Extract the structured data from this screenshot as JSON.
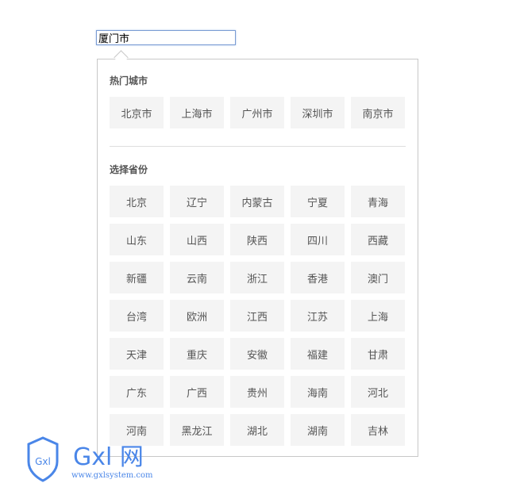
{
  "input": {
    "value": "厦门市"
  },
  "hot": {
    "title": "热门城市",
    "items": [
      "北京市",
      "上海市",
      "广州市",
      "深圳市",
      "南京市"
    ]
  },
  "provinces": {
    "title": "选择省份",
    "items": [
      "北京",
      "辽宁",
      "内蒙古",
      "宁夏",
      "青海",
      "山东",
      "山西",
      "陕西",
      "四川",
      "西藏",
      "新疆",
      "云南",
      "浙江",
      "香港",
      "澳门",
      "台湾",
      "欧洲",
      "江西",
      "江苏",
      "上海",
      "天津",
      "重庆",
      "安徽",
      "福建",
      "甘肃",
      "广东",
      "广西",
      "贵州",
      "海南",
      "河北",
      "河南",
      "黑龙江",
      "湖北",
      "湖南",
      "吉林"
    ]
  },
  "watermark": {
    "logo": "Gxl",
    "brand": "Gxl 网",
    "url": "www.gxlsystem.com",
    "color": "#4a86e8"
  }
}
